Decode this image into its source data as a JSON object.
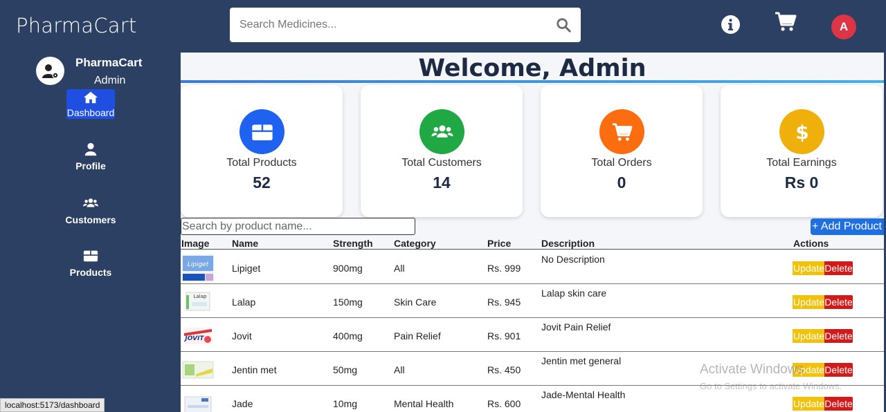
{
  "app": {
    "brand": "PharmaCart"
  },
  "header": {
    "search_placeholder": "Search Medicines...",
    "avatar_initial": "A",
    "icons": [
      "search-icon",
      "info-icon",
      "cart-icon"
    ]
  },
  "sidebar": {
    "name": "PharmaCart",
    "role": "Admin",
    "items": [
      {
        "label": "Dashboard",
        "icon": "home-icon",
        "active": true
      },
      {
        "label": "Profile",
        "icon": "user-icon"
      },
      {
        "label": "Customers",
        "icon": "users-icon"
      },
      {
        "label": "Products",
        "icon": "box-icon"
      }
    ]
  },
  "main": {
    "welcome": "Welcome, Admin",
    "cards": [
      {
        "label": "Total Products",
        "value": "52",
        "color": "#1f62f0",
        "icon": "box-icon"
      },
      {
        "label": "Total Customers",
        "value": "14",
        "color": "#1fa843",
        "icon": "users-icon"
      },
      {
        "label": "Total Orders",
        "value": "0",
        "color": "#fb6d0f",
        "icon": "cart-icon"
      },
      {
        "label": "Total Earnings",
        "value": "Rs 0",
        "color": "#efb00c",
        "icon": "dollar-icon"
      }
    ],
    "product_search_placeholder": "Search by product name...",
    "add_button": "+ Add Product",
    "table": {
      "headers": [
        "Image",
        "Name",
        "Strength",
        "Category",
        "Price",
        "Description",
        "Actions"
      ],
      "rows": [
        {
          "name": "Lipiget",
          "strength": "900mg",
          "category": "All",
          "price": "Rs. 999",
          "description": "No Description"
        },
        {
          "name": "Lalap",
          "strength": "150mg",
          "category": "Skin Care",
          "price": "Rs. 945",
          "description": "Lalap skin care"
        },
        {
          "name": "Jovit",
          "strength": "400mg",
          "category": "Pain Relief",
          "price": "Rs. 901",
          "description": "Jovit Pain Relief"
        },
        {
          "name": "Jentin met",
          "strength": "50mg",
          "category": "All",
          "price": "Rs. 450",
          "description": "Jentin met general"
        },
        {
          "name": "Jade",
          "strength": "10mg",
          "category": "Mental Health",
          "price": "Rs. 600",
          "description": "Jade-Mental Health"
        }
      ],
      "update_label": "Update",
      "delete_label": "Delete"
    }
  },
  "overlay": {
    "watermark_title": "Activate Windows",
    "watermark_sub": "Go to Settings to activate Windows.",
    "status_url": "localhost:5173/dashboard"
  }
}
